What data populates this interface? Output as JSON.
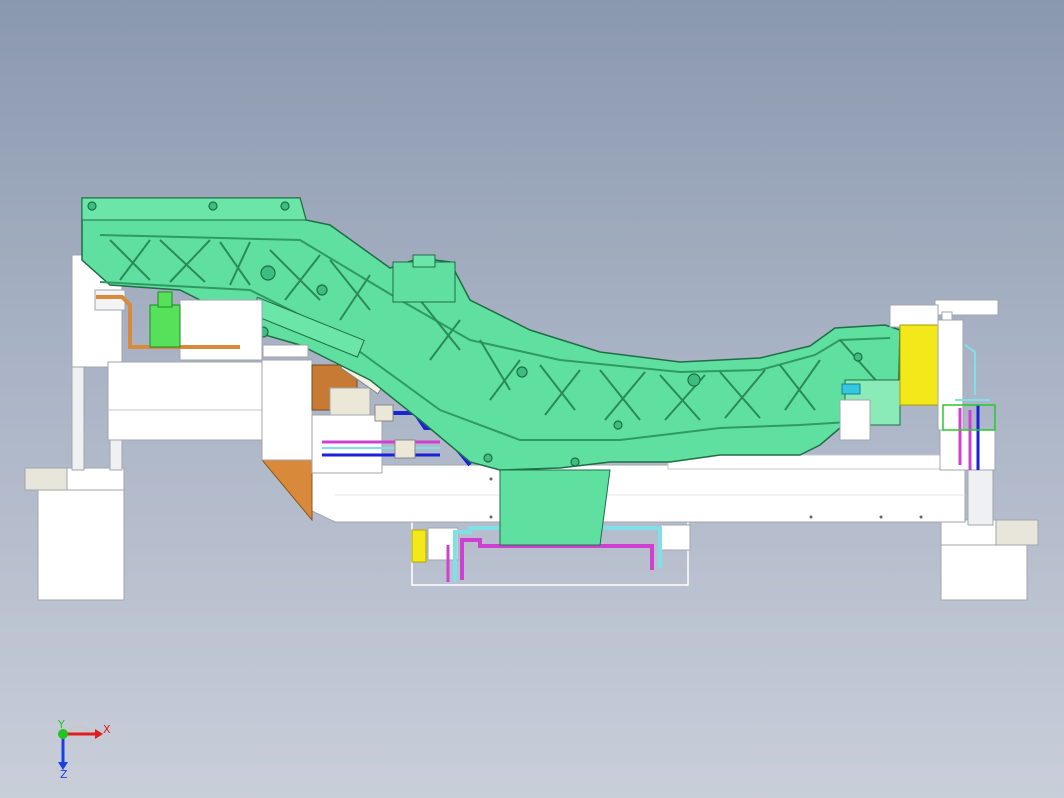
{
  "viewport": {
    "background_top": "#8a98ae",
    "background_bottom": "#c9ced9"
  },
  "colors": {
    "part_green": "#5fe0a0",
    "part_green_edge": "#1f6e45",
    "rib_green": "#3bb57a",
    "fixture_white": "#ffffff",
    "fixture_edge": "#9aa0a8",
    "copper": "#d88a3a",
    "bright_green": "#55e15a",
    "blue_pipe": "#1a22d8",
    "magenta_pipe": "#d040d0",
    "cyan_pipe": "#7fe0e8",
    "yellow": "#f2e81a",
    "cream": "#ece8d8",
    "cyan_block": "#33c8e0"
  },
  "triad": {
    "x_label": "X",
    "y_label": "Y",
    "z_label": "Z",
    "x_color": "#e21b1b",
    "y_color": "#21c421",
    "z_color": "#1b3fe2"
  }
}
